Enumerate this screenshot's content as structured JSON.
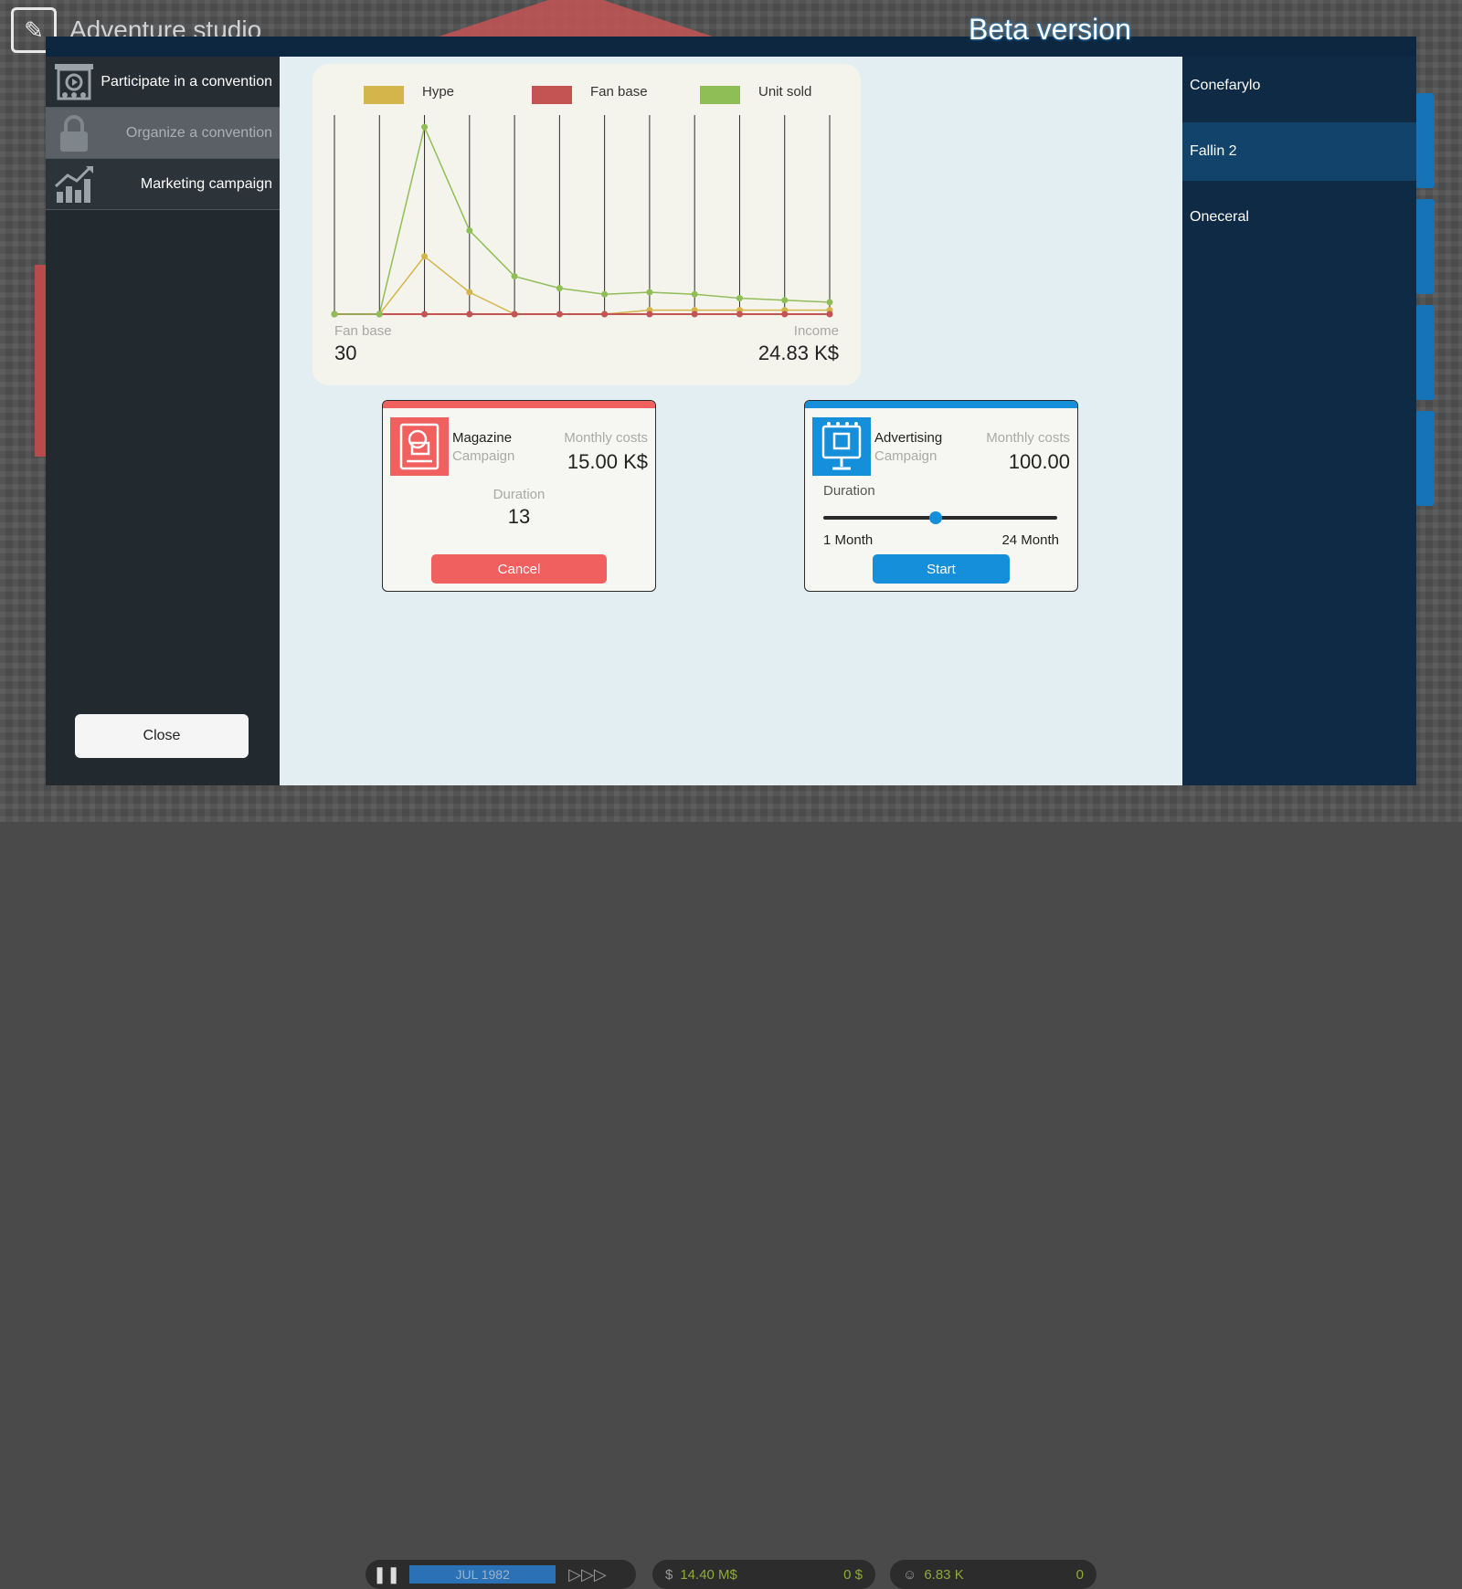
{
  "background": {
    "studio_name": "Adventure studio",
    "beta_label": "Beta version",
    "bottom_bar": {
      "date": "JUL 1982",
      "money": "14.40 M$",
      "money_delta": "0 $",
      "fans": "6.83 K",
      "fans_delta": "0"
    }
  },
  "menu": {
    "items": [
      {
        "label": "Participate in a convention",
        "icon": "convention-stage-icon",
        "enabled": true
      },
      {
        "label": "Organize a convention",
        "icon": "lock-icon",
        "enabled": false
      },
      {
        "label": "Marketing campaign",
        "icon": "growth-chart-icon",
        "enabled": true
      }
    ],
    "close_label": "Close"
  },
  "games": {
    "items": [
      "Conefarylo",
      "Fallin 2",
      "Oneceral"
    ],
    "selected": "Fallin 2"
  },
  "chart": {
    "stat_left_label": "Fan base",
    "stat_left_value": "30",
    "stat_right_label": "Income",
    "stat_right_value": "24.83 K$"
  },
  "chart_data": {
    "type": "line",
    "title": "",
    "xlabel": "",
    "ylabel": "",
    "x": [
      1,
      2,
      3,
      4,
      5,
      6,
      7,
      8,
      9,
      10,
      11,
      12
    ],
    "ylim": [
      0,
      100
    ],
    "grid": "vertical",
    "legend_placement": "top",
    "series": [
      {
        "name": "Hype",
        "color": "#d4b54b",
        "values": [
          0,
          0,
          29,
          11,
          0,
          0,
          0,
          2,
          2,
          2,
          2,
          2
        ]
      },
      {
        "name": "Fan base",
        "color": "#c45353",
        "values": [
          0,
          0,
          0,
          0,
          0,
          0,
          0,
          0,
          0,
          0,
          0,
          0
        ]
      },
      {
        "name": "Unit sold",
        "color": "#8fbe56",
        "values": [
          0,
          0,
          94,
          42,
          19,
          13,
          10,
          11,
          10,
          8,
          7,
          6
        ]
      }
    ]
  },
  "campaigns": [
    {
      "name": "Magazine",
      "subtitle": "Campaign",
      "cost_label": "Monthly costs",
      "cost": "15.00 K$",
      "duration_label": "Duration",
      "duration": "13",
      "button": "Cancel",
      "accent": "#f0605e",
      "icon": "magazine-icon"
    },
    {
      "name": "Advertising",
      "subtitle": "Campaign",
      "cost_label": "Monthly costs",
      "cost": "100.00",
      "duration_label": "Duration",
      "slider_min_label": "1 Month",
      "slider_max_label": "24 Month",
      "slider_value": 0.48,
      "button": "Start",
      "accent": "#168fda",
      "icon": "billboard-icon"
    }
  ]
}
